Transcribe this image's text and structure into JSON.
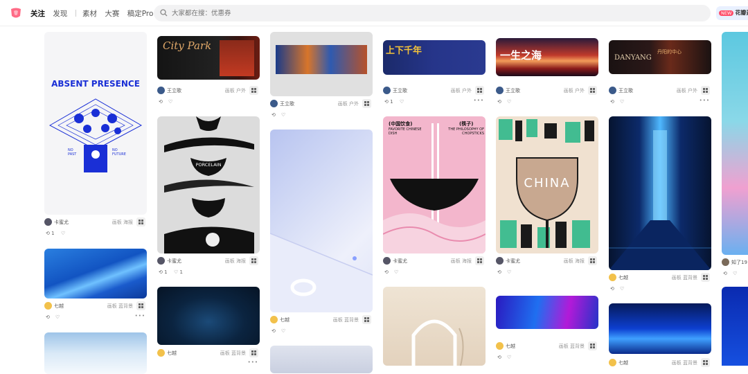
{
  "nav": {
    "items": [
      "关注",
      "发现",
      "素材",
      "大赛",
      "稿定Pro"
    ],
    "search_placeholder": "大家都在搜：优惠券",
    "new_badge": "NEW",
    "user_short": "花瓣素"
  },
  "cards": {
    "c1": {
      "author": "卡蜜尤",
      "tags": "画板 海报",
      "likes": "1"
    },
    "c2": {
      "author": "七越",
      "tags": "画板 蓝背景"
    },
    "c3": {
      "author": "王立歌",
      "tags": "画板 户外"
    },
    "c4": {
      "author": "卡蜜尤",
      "tags": "画板 海报",
      "repins": "1",
      "likes": "1"
    },
    "c5": {
      "author": "七越",
      "tags": "画板 蓝背景"
    },
    "c6": {
      "author": "王立歌",
      "tags": "画板 户外"
    },
    "c7": {
      "author": "七越",
      "tags": "画板 蓝背景"
    },
    "c8": {
      "author": "王立歌",
      "tags": "画板 户外",
      "repins": "1"
    },
    "c9": {
      "author": "卡蜜尤",
      "tags": "画板 海报"
    },
    "c10": {
      "author": "王立歌",
      "tags": "画板 户外"
    },
    "c11": {
      "author": "卡蜜尤",
      "tags": "画板 海报"
    },
    "c12": {
      "author": "七越",
      "tags": "画板 蓝背景"
    },
    "c13": {
      "author": "王立歌",
      "tags": "画板 户外"
    },
    "c14": {
      "author": "七越",
      "tags": "画板 蓝背景"
    },
    "c15": {
      "author": "七越",
      "tags": "画板 蓝背景"
    },
    "c16": {
      "author": "知了19"
    }
  },
  "posters": {
    "absent": "ABSENT PRESENCE",
    "absent_l": "NO PAST",
    "absent_r": "NO FUTURE",
    "porcelain": "PORCELAIN",
    "city": "City Park",
    "chopsticks_l": "(中国饮食)",
    "chopsticks_l2": "FAVORITE CHINESE DISH",
    "chopsticks_r": "(筷子)",
    "chopsticks_r2": "THE PHILOSOPHY OF CHOPSTICKS",
    "china": "CHINA",
    "danyang": "DANYANG",
    "danyang_cn": "丹阳的中心",
    "banner3": "上下千年",
    "banner4": "一生之海"
  },
  "colors": {
    "accent": "#ff4d6a",
    "search_bg": "#f2f2f3"
  }
}
